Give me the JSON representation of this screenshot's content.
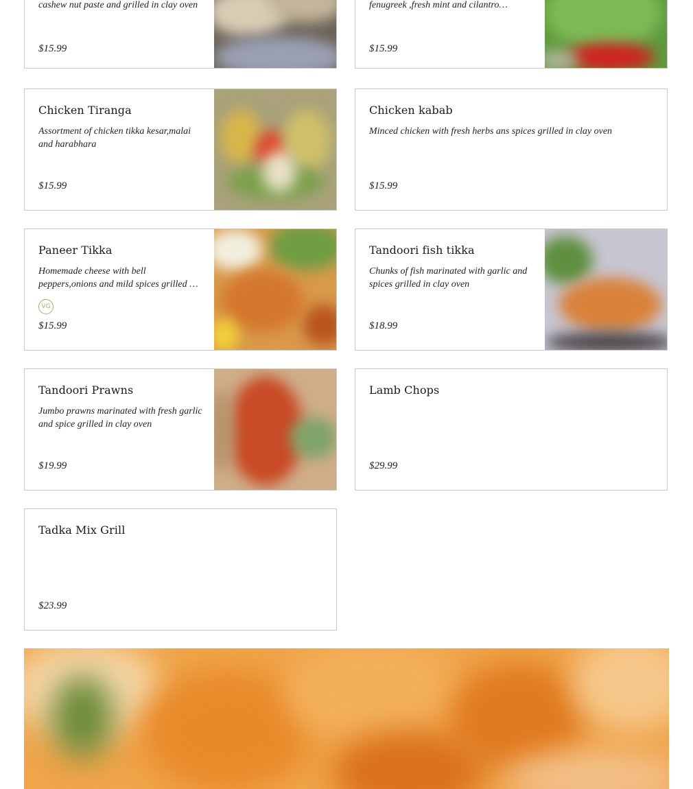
{
  "menu_items": [
    {
      "id": "top-left",
      "name": "",
      "description": "cashew nut paste and grilled in clay oven",
      "price": "$15.99",
      "has_image": true,
      "image_icon": "food-photo-icon"
    },
    {
      "id": "top-right",
      "name": "",
      "description": "fenugreek ,fresh mint and cilantro…",
      "price": "$15.99",
      "has_image": true,
      "image_icon": "food-photo-icon"
    },
    {
      "id": "chicken-tiranga",
      "name": "Chicken Tiranga",
      "description": "Assortment of chicken tikka kesar,malai and harabhara",
      "price": "$15.99",
      "has_image": true,
      "image_icon": "food-photo-icon"
    },
    {
      "id": "chicken-kabab",
      "name": "Chicken kabab",
      "description": "Minced chicken with fresh herbs ans spices grilled in clay oven",
      "price": "$15.99",
      "has_image": false
    },
    {
      "id": "paneer-tikka",
      "name": "Paneer Tikka",
      "description": "Homemade cheese with bell peppers,onions and mild spices grilled …",
      "price": "$15.99",
      "badge": "VG",
      "has_image": true,
      "image_icon": "food-photo-icon"
    },
    {
      "id": "tandoori-fish-tikka",
      "name": "Tandoori fish tikka",
      "description": "Chunks of fish marinated with garlic and spices grilled in clay oven",
      "price": "$18.99",
      "has_image": true,
      "image_icon": "food-photo-icon"
    },
    {
      "id": "tandoori-prawns",
      "name": "Tandoori Prawns",
      "description": "Jumbo prawns marinated with fresh garlic and spice grilled in clay oven",
      "price": "$19.99",
      "has_image": true,
      "image_icon": "food-photo-icon"
    },
    {
      "id": "lamb-chops",
      "name": "Lamb Chops",
      "description": "",
      "price": "$29.99",
      "has_image": false
    },
    {
      "id": "tadka-mix-grill",
      "name": "Tadka Mix Grill",
      "description": "",
      "price": "$23.99",
      "has_image": false
    }
  ],
  "badge_color": "#9ab36a",
  "border_color": "#c9c9c9",
  "banner": {
    "image_icon": "samosa-photo-icon"
  }
}
